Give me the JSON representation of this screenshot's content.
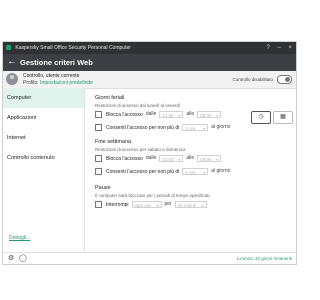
{
  "window": {
    "title": "Kaspersky Small Office Security Personal Computer",
    "controls": [
      "?",
      "–",
      "×"
    ]
  },
  "header": {
    "title": "Gestione criteri Web",
    "back_icon": "arrow-left"
  },
  "user": {
    "name": "Controllo, utente corrente",
    "profile_label": "Profilo:",
    "profile_value": "Impostazioni predefinite",
    "status": "Controllo disabilitato",
    "toggle_on": false
  },
  "sidebar": {
    "items": [
      {
        "label": "Computer",
        "active": true
      },
      {
        "label": "Applicazioni",
        "active": false
      },
      {
        "label": "Internet",
        "active": false
      },
      {
        "label": "Controllo contenuto",
        "active": false
      }
    ],
    "details_link": "Dettagli..."
  },
  "content": {
    "weekdays": {
      "title": "Giorni feriali",
      "desc": "Restrizioni di accesso dal lunedì al venerdì",
      "block_label": "Blocca l'accesso",
      "from_label": "dalle",
      "from_value": "21:00",
      "to_label": "alle",
      "to_value": "06:00",
      "limit_label": "Consenti l'accesso per non più di",
      "limit_value": "2 ore",
      "per_day": "al giorno"
    },
    "weekend": {
      "title": "Fine settimana",
      "desc": "Restrizioni di accesso per sabato e domenica",
      "block_label": "Blocca l'accesso",
      "from_label": "dalle",
      "from_value": "21:00",
      "to_label": "alle",
      "to_value": "06:00",
      "limit_label": "Consenti l'accesso per non più di",
      "limit_value": "2 ore",
      "per_day": "al giorno"
    },
    "pauses": {
      "title": "Pause",
      "desc": "Il computer sarà bloccato per i periodi di tempo specificati.",
      "interrupt_label": "Interrompi",
      "interval_value": "ogni ora",
      "for_label": "per",
      "duration_value": "15 minuti"
    },
    "view_buttons": [
      "clock-icon",
      "calendar-icon"
    ]
  },
  "footer": {
    "license": "Licenza: 32 giorni rimanenti"
  },
  "colors": {
    "accent": "#1f9d6b",
    "header_bg": "#3c3f44",
    "titlebar_bg": "#2f3135"
  }
}
